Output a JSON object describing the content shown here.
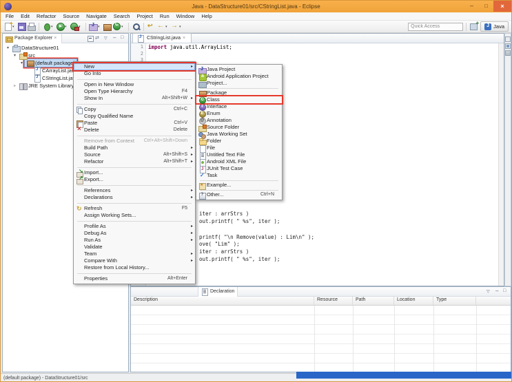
{
  "window": {
    "title": "Java - DataStructure01/src/CStringList.java - Eclipse"
  },
  "menubar": {
    "items": [
      "File",
      "Edit",
      "Refactor",
      "Source",
      "Navigate",
      "Search",
      "Project",
      "Run",
      "Window",
      "Help"
    ]
  },
  "toolbar": {
    "icons": [
      {
        "name": "new-wizard-icon",
        "drop": "has-drop"
      },
      {
        "name": "save-icon"
      },
      {
        "name": "print-icon"
      },
      {
        "name": "toolbar-separator",
        "cls": "toolbar-separator",
        "inter": "false"
      },
      {
        "name": "debug-icon",
        "drop": "has-drop"
      },
      {
        "name": "run-icon",
        "drop": "has-drop"
      },
      {
        "name": "external-tools-icon",
        "drop": "has-drop"
      },
      {
        "name": "toolbar-separator",
        "cls": "toolbar-separator",
        "inter": "false"
      },
      {
        "name": "new-java-project-icon",
        "drop": "has-drop"
      },
      {
        "name": "new-package-icon"
      },
      {
        "name": "new-class-icon",
        "drop": "has-drop"
      },
      {
        "name": "toolbar-separator",
        "cls": "toolbar-separator",
        "inter": "false"
      },
      {
        "name": "search-icon"
      },
      {
        "name": "toolbar-separator",
        "cls": "toolbar-separator",
        "inter": "false"
      },
      {
        "name": "last-edit-location-icon"
      },
      {
        "name": "back-icon",
        "drop": "has-drop"
      },
      {
        "name": "forward-icon",
        "drop": "has-drop"
      }
    ],
    "quick_access_placeholder": "Quick Access",
    "perspective_label": "Java"
  },
  "package_explorer": {
    "tab": "Package Explorer",
    "header_icons": [
      "collapse-all-icon",
      "link-with-editor-icon",
      "view-menu-icon",
      "minimize-icon",
      "maximize-icon"
    ],
    "tree": [
      {
        "label": "DataStructure01",
        "icon": "project-icon",
        "depth": "d0",
        "arrow": "expanded"
      },
      {
        "label": "src",
        "icon": "source-folder-icon",
        "depth": "d1",
        "arrow": "expanded"
      },
      {
        "label": "(default package)",
        "icon": "package-icon",
        "depth": "d2",
        "arrow": "expanded",
        "cls": "selected redbox"
      },
      {
        "label": "CArrayList.java",
        "icon": "java-file-icon",
        "depth": "d3"
      },
      {
        "label": "CStringList.java",
        "icon": "java-file-icon",
        "depth": "d3"
      },
      {
        "label": "JRE System Library",
        "icon": "library-icon",
        "depth": "d1",
        "arrow": "collapsed"
      }
    ]
  },
  "editor": {
    "tab": "CStringList.java",
    "line_numbers": [
      "1",
      "2",
      "3"
    ],
    "code_line_1": {
      "keyword": "import",
      "rest": " java.util.ArrayList;"
    },
    "visible_fragments": [
      "iter : arrStrs )",
      "out.printf( \" %s\", iter );",
      "printf( \"\\n Remove(value) : Lim\\n\" );",
      "ove( \"Lim\" );",
      "iter : arrStrs )",
      "out.printf( \" %s\", iter );"
    ]
  },
  "context_menu": {
    "items": [
      {
        "label": "New",
        "sub": "has-sub",
        "cls": "selected redbox"
      },
      {
        "label": "Go Into"
      },
      {
        "cls": "separator",
        "inter": "false"
      },
      {
        "label": "Open in New Window"
      },
      {
        "label": "Open Type Hierarchy",
        "shortcut": "F4"
      },
      {
        "label": "Show In",
        "shortcut": "Alt+Shift+W",
        "sub": "has-sub"
      },
      {
        "cls": "separator",
        "inter": "false"
      },
      {
        "label": "Copy",
        "shortcut": "Ctrl+C",
        "icon": "copy-icon"
      },
      {
        "label": "Copy Qualified Name"
      },
      {
        "label": "Paste",
        "shortcut": "Ctrl+V",
        "icon": "paste-icon"
      },
      {
        "label": "Delete",
        "shortcut": "Delete",
        "icon": "delete-icon"
      },
      {
        "cls": "separator",
        "inter": "false"
      },
      {
        "label": "Remove from Context",
        "shortcut": "Ctrl+Alt+Shift+Down",
        "cls": "disabled"
      },
      {
        "label": "Build Path",
        "sub": "has-sub"
      },
      {
        "label": "Source",
        "shortcut": "Alt+Shift+S",
        "sub": "has-sub"
      },
      {
        "label": "Refactor",
        "shortcut": "Alt+Shift+T",
        "sub": "has-sub"
      },
      {
        "cls": "separator",
        "inter": "false"
      },
      {
        "label": "Import...",
        "icon": "import-icon"
      },
      {
        "label": "Export...",
        "icon": "export-icon"
      },
      {
        "cls": "separator",
        "inter": "false"
      },
      {
        "label": "References",
        "sub": "has-sub"
      },
      {
        "label": "Declarations",
        "sub": "has-sub"
      },
      {
        "cls": "separator",
        "inter": "false"
      },
      {
        "label": "Refresh",
        "shortcut": "F5",
        "icon": "refresh-icon"
      },
      {
        "label": "Assign Working Sets..."
      },
      {
        "cls": "separator",
        "inter": "false"
      },
      {
        "label": "Profile As",
        "sub": "has-sub"
      },
      {
        "label": "Debug As",
        "sub": "has-sub"
      },
      {
        "label": "Run As",
        "sub": "has-sub"
      },
      {
        "label": "Validate"
      },
      {
        "label": "Team",
        "sub": "has-sub"
      },
      {
        "label": "Compare With",
        "sub": "has-sub"
      },
      {
        "label": "Restore from Local History..."
      },
      {
        "cls": "separator",
        "inter": "false"
      },
      {
        "label": "Properties",
        "shortcut": "Alt+Enter"
      }
    ]
  },
  "new_submenu": {
    "items": [
      {
        "label": "Java Project",
        "icon": "java-project-icon"
      },
      {
        "label": "Android Application Project",
        "icon": "android-project-icon"
      },
      {
        "label": "Project...",
        "icon": "project-wizard-icon"
      },
      {
        "cls": "separator",
        "inter": "false"
      },
      {
        "label": "Package",
        "icon": "package-icon"
      },
      {
        "label": "Class",
        "icon": "class-icon",
        "cls": "redbox"
      },
      {
        "label": "Interface",
        "icon": "interface-icon"
      },
      {
        "label": "Enum",
        "icon": "enum-icon"
      },
      {
        "label": "Annotation",
        "icon": "annotation-icon"
      },
      {
        "label": "Source Folder",
        "icon": "source-folder-icon"
      },
      {
        "label": "Java Working Set",
        "icon": "working-set-icon"
      },
      {
        "label": "Folder",
        "icon": "folder-icon"
      },
      {
        "label": "File",
        "icon": "file-icon"
      },
      {
        "label": "Untitled Text File",
        "icon": "text-file-icon"
      },
      {
        "label": "Android XML File",
        "icon": "xml-file-icon"
      },
      {
        "label": "JUnit Test Case",
        "icon": "junit-icon"
      },
      {
        "label": "Task",
        "icon": "task-icon"
      },
      {
        "cls": "separator",
        "inter": "false"
      },
      {
        "label": "Example...",
        "icon": "example-icon"
      },
      {
        "cls": "separator",
        "inter": "false"
      },
      {
        "label": "Other...",
        "shortcut": "Ctrl+N",
        "icon": "other-icon"
      }
    ]
  },
  "bottom_panel": {
    "tab": "Declaration",
    "header_icons": [
      "view-menu-icon",
      "minimize-icon",
      "maximize-icon"
    ],
    "columns": [
      "Description",
      "Resource",
      "Path",
      "Location",
      "Type"
    ]
  },
  "right_rail": {
    "icons": [
      "restore-icon",
      "task-list-icon",
      "outline-icon"
    ]
  },
  "statusbar": {
    "text": "(default package) - DataStructure01/src"
  }
}
